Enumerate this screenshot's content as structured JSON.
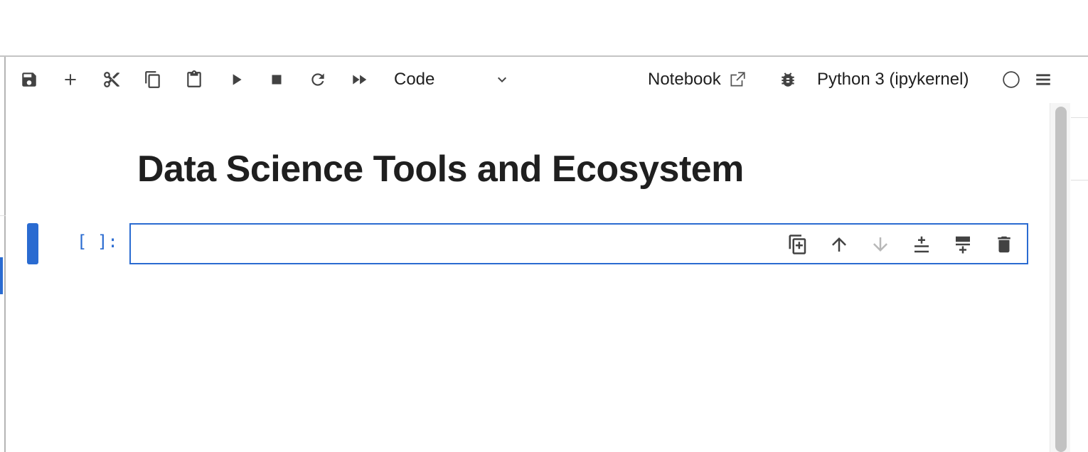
{
  "toolbar": {
    "save": {
      "icon": "save-icon"
    },
    "insert": {
      "icon": "plus-icon"
    },
    "cut": {
      "icon": "scissors-icon"
    },
    "copy": {
      "icon": "copy-icon"
    },
    "paste": {
      "icon": "paste-icon"
    },
    "run": {
      "icon": "play-icon"
    },
    "interrupt": {
      "icon": "stop-icon"
    },
    "restart": {
      "icon": "refresh-icon"
    },
    "run_all": {
      "icon": "fast-forward-icon"
    },
    "cell_type": {
      "selected": "Code",
      "icon": "chevron-down-icon"
    },
    "notebook_link": {
      "label": "Notebook",
      "icon": "external-link-icon"
    },
    "debugger": {
      "icon": "bug-icon"
    },
    "kernel": {
      "name": "Python 3 (ipykernel)",
      "status_icon": "kernel-idle-circle-icon"
    },
    "menu": {
      "icon": "hamburger-menu-icon"
    }
  },
  "notebook": {
    "heading": "Data Science Tools and Ecosystem",
    "cells": [
      {
        "prompt": "[ ]:",
        "source": ""
      }
    ],
    "cell_toolbar": [
      {
        "icon": "duplicate-icon"
      },
      {
        "icon": "arrow-up-icon"
      },
      {
        "icon": "arrow-down-icon",
        "disabled": true
      },
      {
        "icon": "insert-above-icon"
      },
      {
        "icon": "insert-below-icon"
      },
      {
        "icon": "trash-icon"
      }
    ]
  },
  "colors": {
    "accent": "#2a6bd1",
    "icon": "#424242",
    "icon_disabled": "#b8b8b8"
  }
}
